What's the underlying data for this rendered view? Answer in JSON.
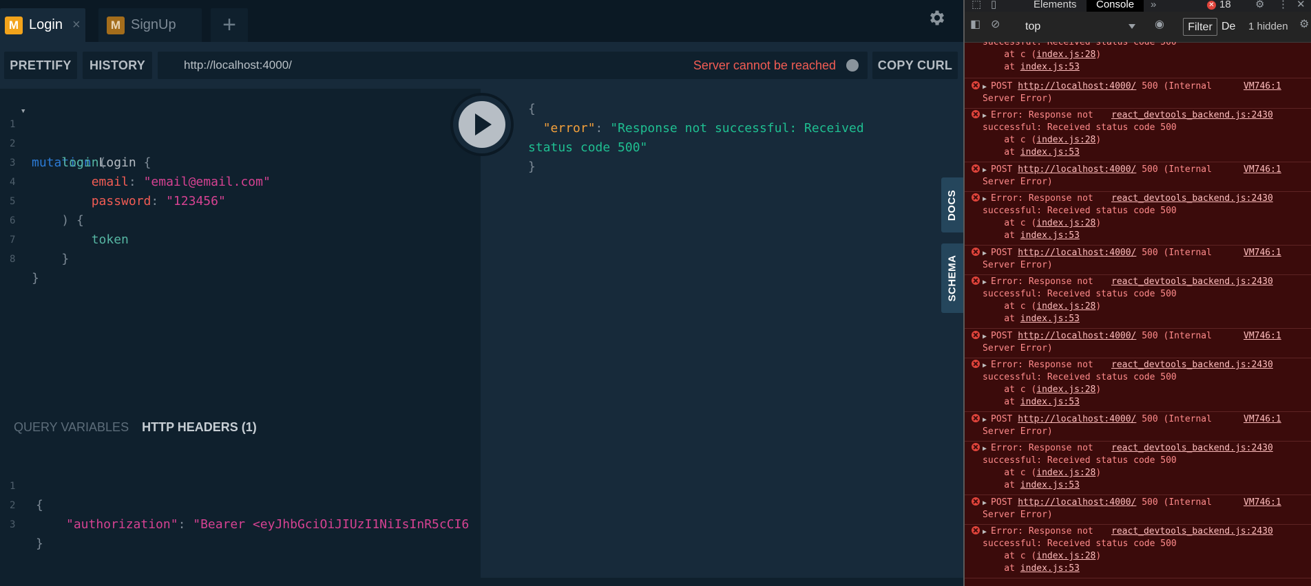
{
  "tabs": [
    {
      "logo": "M",
      "label": "Login",
      "close": "×"
    },
    {
      "logo": "M",
      "label": "SignUp"
    }
  ],
  "tab_add": "+",
  "toolbar": {
    "prettify": "PRETTIFY",
    "history": "HISTORY",
    "url": "http://localhost:4000/",
    "server_status": "Server cannot be reached",
    "copy_curl": "COPY CURL"
  },
  "editor": {
    "line_numbers": [
      "1",
      "2",
      "3",
      "4",
      "5",
      "6",
      "7",
      "8"
    ],
    "l1_kw": "mutation",
    "l1_name": "Login",
    "l1_brace": "{",
    "l2_field": "login",
    "l2_paren": "(",
    "l3_arg": "email",
    "l3_colon": ":",
    "l3_val": "\"email@email.com\"",
    "l4_arg": "password",
    "l4_colon": ":",
    "l4_val": "\"123456\"",
    "l5": ") {",
    "l6_field": "token",
    "l7": "}",
    "l8": "}"
  },
  "result": {
    "open": "{",
    "key": "\"error\"",
    "colon": ": ",
    "value1": "\"Response not successful: Received",
    "value2": "status code 500\"",
    "close": "}"
  },
  "side_tabs": {
    "docs": "DOCS",
    "schema": "SCHEMA"
  },
  "variables": {
    "tab1": "QUERY VARIABLES",
    "tab2": "HTTP HEADERS (1)",
    "line_numbers": [
      "1",
      "2",
      "3"
    ],
    "open": "{",
    "key": "\"authorization\"",
    "colon": ": ",
    "value": "\"Bearer <eyJhbGciOiJIUzI1NiIsInR5cCI6",
    "close": "}"
  },
  "devtools": {
    "tab_elements": "Elements",
    "tab_console": "Console",
    "more": "»",
    "error_count": "18",
    "context": "top",
    "filter": "Filter",
    "levels": "De",
    "hidden": "1 hidden",
    "top_partial": {
      "line1": "successful: Received status code 500",
      "line2_pre": "    at c (",
      "line2_link": "index.js:28",
      "line2_post": ")",
      "line3_pre": "    at ",
      "line3_link": "index.js:53"
    },
    "post": {
      "method": "POST",
      "url": "http://localhost:4000/",
      "status": "500 (Internal",
      "status2": "Server Error)",
      "source": "VM746:1"
    },
    "error": {
      "msg": "Error: Response not",
      "source": "react_devtools_backend.js:2430",
      "line2": "successful: Received status code 500",
      "line3_pre": "    at c (",
      "line3_link": "index.js:28",
      "line3_post": ")",
      "line4_pre": "    at ",
      "line4_link": "index.js:53"
    }
  },
  "colors": {
    "accent": "#f2a31b",
    "error_red": "#f25c54",
    "console_bg": "#3b0b0b"
  }
}
